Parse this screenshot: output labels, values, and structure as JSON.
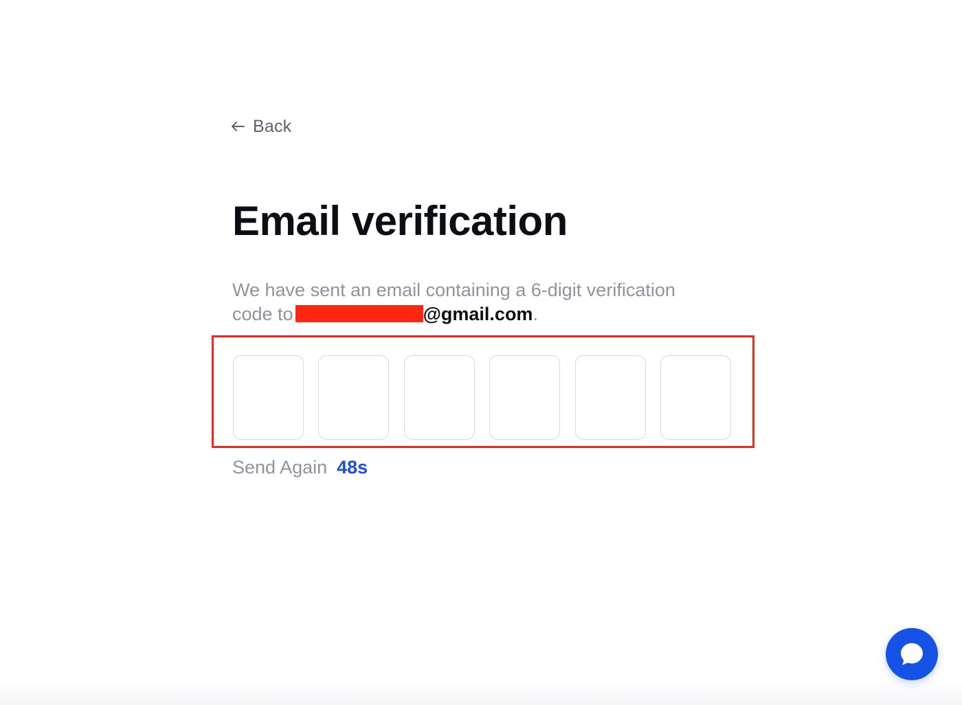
{
  "nav": {
    "back_label": "Back"
  },
  "page": {
    "title": "Email verification",
    "description_line1": "We have sent an email containing a 6-digit verification",
    "description_line2_prefix": "code to",
    "email_domain": "@gmail.com",
    "description_suffix": "."
  },
  "code_inputs": [
    "",
    "",
    "",
    "",
    "",
    ""
  ],
  "resend": {
    "label": "Send Again",
    "countdown": "48s"
  },
  "icons": {
    "back": "arrow-left-icon",
    "chat": "chat-bubble-icon"
  },
  "colors": {
    "accent": "#1a4fe0",
    "chat_button": "#1752e6",
    "highlight": "#ec2a1c",
    "redaction": "#fb2714",
    "title": "#0b0e14",
    "muted_text": "#8f949c"
  }
}
